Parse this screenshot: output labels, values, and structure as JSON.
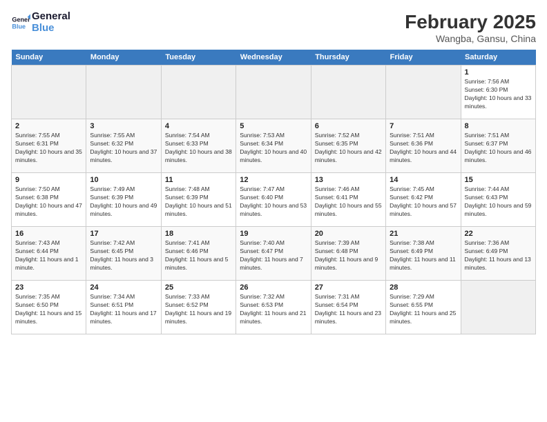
{
  "header": {
    "logo_line1": "General",
    "logo_line2": "Blue",
    "month_year": "February 2025",
    "location": "Wangba, Gansu, China"
  },
  "weekdays": [
    "Sunday",
    "Monday",
    "Tuesday",
    "Wednesday",
    "Thursday",
    "Friday",
    "Saturday"
  ],
  "weeks": [
    [
      {
        "day": "",
        "info": ""
      },
      {
        "day": "",
        "info": ""
      },
      {
        "day": "",
        "info": ""
      },
      {
        "day": "",
        "info": ""
      },
      {
        "day": "",
        "info": ""
      },
      {
        "day": "",
        "info": ""
      },
      {
        "day": "1",
        "info": "Sunrise: 7:56 AM\nSunset: 6:30 PM\nDaylight: 10 hours and 33 minutes."
      }
    ],
    [
      {
        "day": "2",
        "info": "Sunrise: 7:55 AM\nSunset: 6:31 PM\nDaylight: 10 hours and 35 minutes."
      },
      {
        "day": "3",
        "info": "Sunrise: 7:55 AM\nSunset: 6:32 PM\nDaylight: 10 hours and 37 minutes."
      },
      {
        "day": "4",
        "info": "Sunrise: 7:54 AM\nSunset: 6:33 PM\nDaylight: 10 hours and 38 minutes."
      },
      {
        "day": "5",
        "info": "Sunrise: 7:53 AM\nSunset: 6:34 PM\nDaylight: 10 hours and 40 minutes."
      },
      {
        "day": "6",
        "info": "Sunrise: 7:52 AM\nSunset: 6:35 PM\nDaylight: 10 hours and 42 minutes."
      },
      {
        "day": "7",
        "info": "Sunrise: 7:51 AM\nSunset: 6:36 PM\nDaylight: 10 hours and 44 minutes."
      },
      {
        "day": "8",
        "info": "Sunrise: 7:51 AM\nSunset: 6:37 PM\nDaylight: 10 hours and 46 minutes."
      }
    ],
    [
      {
        "day": "9",
        "info": "Sunrise: 7:50 AM\nSunset: 6:38 PM\nDaylight: 10 hours and 47 minutes."
      },
      {
        "day": "10",
        "info": "Sunrise: 7:49 AM\nSunset: 6:39 PM\nDaylight: 10 hours and 49 minutes."
      },
      {
        "day": "11",
        "info": "Sunrise: 7:48 AM\nSunset: 6:39 PM\nDaylight: 10 hours and 51 minutes."
      },
      {
        "day": "12",
        "info": "Sunrise: 7:47 AM\nSunset: 6:40 PM\nDaylight: 10 hours and 53 minutes."
      },
      {
        "day": "13",
        "info": "Sunrise: 7:46 AM\nSunset: 6:41 PM\nDaylight: 10 hours and 55 minutes."
      },
      {
        "day": "14",
        "info": "Sunrise: 7:45 AM\nSunset: 6:42 PM\nDaylight: 10 hours and 57 minutes."
      },
      {
        "day": "15",
        "info": "Sunrise: 7:44 AM\nSunset: 6:43 PM\nDaylight: 10 hours and 59 minutes."
      }
    ],
    [
      {
        "day": "16",
        "info": "Sunrise: 7:43 AM\nSunset: 6:44 PM\nDaylight: 11 hours and 1 minute."
      },
      {
        "day": "17",
        "info": "Sunrise: 7:42 AM\nSunset: 6:45 PM\nDaylight: 11 hours and 3 minutes."
      },
      {
        "day": "18",
        "info": "Sunrise: 7:41 AM\nSunset: 6:46 PM\nDaylight: 11 hours and 5 minutes."
      },
      {
        "day": "19",
        "info": "Sunrise: 7:40 AM\nSunset: 6:47 PM\nDaylight: 11 hours and 7 minutes."
      },
      {
        "day": "20",
        "info": "Sunrise: 7:39 AM\nSunset: 6:48 PM\nDaylight: 11 hours and 9 minutes."
      },
      {
        "day": "21",
        "info": "Sunrise: 7:38 AM\nSunset: 6:49 PM\nDaylight: 11 hours and 11 minutes."
      },
      {
        "day": "22",
        "info": "Sunrise: 7:36 AM\nSunset: 6:49 PM\nDaylight: 11 hours and 13 minutes."
      }
    ],
    [
      {
        "day": "23",
        "info": "Sunrise: 7:35 AM\nSunset: 6:50 PM\nDaylight: 11 hours and 15 minutes."
      },
      {
        "day": "24",
        "info": "Sunrise: 7:34 AM\nSunset: 6:51 PM\nDaylight: 11 hours and 17 minutes."
      },
      {
        "day": "25",
        "info": "Sunrise: 7:33 AM\nSunset: 6:52 PM\nDaylight: 11 hours and 19 minutes."
      },
      {
        "day": "26",
        "info": "Sunrise: 7:32 AM\nSunset: 6:53 PM\nDaylight: 11 hours and 21 minutes."
      },
      {
        "day": "27",
        "info": "Sunrise: 7:31 AM\nSunset: 6:54 PM\nDaylight: 11 hours and 23 minutes."
      },
      {
        "day": "28",
        "info": "Sunrise: 7:29 AM\nSunset: 6:55 PM\nDaylight: 11 hours and 25 minutes."
      },
      {
        "day": "",
        "info": ""
      }
    ]
  ]
}
